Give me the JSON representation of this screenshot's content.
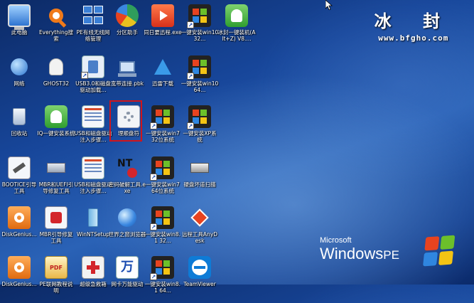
{
  "brand": {
    "title": "冰 封",
    "url": "www.bfgho.com"
  },
  "winpe": {
    "microsoft": "Microsoft",
    "windows": "Windows",
    "pe": "PE"
  },
  "icons": [
    {
      "label": "此电脑",
      "icon": "computer-icon",
      "color": "#4a8fe0"
    },
    {
      "label": "Everything搜索",
      "icon": "magnifier-icon",
      "color": "#f07a1a"
    },
    {
      "label": "PE有线无线网络管理",
      "icon": "network-icon",
      "color": "#3a7fd6"
    },
    {
      "label": "分区助手",
      "icon": "partition-icon",
      "color": "#2f9e5c"
    },
    {
      "label": "同日要迅程.exe",
      "icon": "media-icon",
      "color": "#e8431f"
    },
    {
      "label": "一键安装win10 32...",
      "icon": "windows-icon",
      "color": "#333"
    },
    {
      "label": "冰封一键装机(Alt+Z) V8....",
      "icon": "ghost-icon",
      "color": "#3dac3d"
    },
    {
      "label": "网络",
      "icon": "globe-network-icon",
      "color": "#3a87e0"
    },
    {
      "label": "GHOST32",
      "icon": "ghost32-icon",
      "color": "#e9e9e9"
    },
    {
      "label": "USB3.0和磁盘驱动加载...",
      "icon": "usb-icon",
      "color": "#dde6f2"
    },
    {
      "label": "宽带连接.pbk",
      "icon": "broadband-icon",
      "color": "#cfd8e6"
    },
    {
      "label": "迅雷下载",
      "icon": "thunder-icon",
      "color": "#2f7fd8"
    },
    {
      "label": "一键安装win10 64...",
      "icon": "windows-icon",
      "color": "#333"
    },
    {
      "label": "回收站",
      "icon": "recycle-bin-icon",
      "color": "#c9d6e8"
    },
    {
      "label": "IQ一键安装系统",
      "icon": "iq-ghost-icon",
      "color": "#3dac3d"
    },
    {
      "label": "USB和磁盘驱动注入步骤...",
      "icon": "driver-inject-icon",
      "color": "#dde6f2"
    },
    {
      "label": "理顺盘符",
      "icon": "gear-icon",
      "color": "#e9eef5"
    },
    {
      "label": "一键安装win7 32位系统",
      "icon": "windows-icon",
      "color": "#333"
    },
    {
      "label": "一键安装XP系统",
      "icon": "windows-icon",
      "color": "#333"
    },
    {
      "label": "BOOTICE引导工具",
      "icon": "bootice-icon",
      "color": "#e9eef5"
    },
    {
      "label": "MBR和UEFI引导修复工具",
      "icon": "mbr-icon",
      "color": "#cfd8e6"
    },
    {
      "label": "USB和磁盘驱动注入步骤...",
      "icon": "driver-inject-icon",
      "color": "#dde6f2"
    },
    {
      "label": "密码破解工具.exe",
      "icon": "password-key-icon",
      "color": "#fff"
    },
    {
      "label": "一键安装win7 64位系统",
      "icon": "windows-icon",
      "color": "#333"
    },
    {
      "label": "硬盘坏道扫描",
      "icon": "disk-scan-icon",
      "color": "#d9d9d9"
    },
    {
      "label": "DiskGenius...",
      "icon": "diskgenius-icon",
      "color": "#f07a1a"
    },
    {
      "label": "MBR引导修复工具",
      "icon": "mbr-fix-icon",
      "color": "#e9eef5"
    },
    {
      "label": "WinNTSetup",
      "icon": "winntsetup-icon",
      "color": "#9ec9e8"
    },
    {
      "label": "世界之窗浏览器",
      "icon": "browser-icon",
      "color": "#3a87e0"
    },
    {
      "label": "一键安装win8.1 32...",
      "icon": "windows-icon",
      "color": "#333"
    },
    {
      "label": "远程工具AnyDesk",
      "icon": "anydesk-icon",
      "color": "#e8431f"
    },
    {
      "label": "DiskGenius...",
      "icon": "diskgenius-icon",
      "color": "#f07a1a"
    },
    {
      "label": "PE联网教程说明",
      "icon": "pdf-icon",
      "color": "#f4d27a"
    },
    {
      "label": "超级急救箱",
      "icon": "rescue-icon",
      "color": "#d3252b"
    },
    {
      "label": "网卡万能驱动",
      "icon": "wanneng-icon",
      "color": "#3a7fd6"
    },
    {
      "label": "一键安装win8.1 64...",
      "icon": "windows-icon",
      "color": "#333"
    },
    {
      "label": "TeamViewer",
      "icon": "teamviewer-icon",
      "color": "#0e7bd6"
    }
  ]
}
